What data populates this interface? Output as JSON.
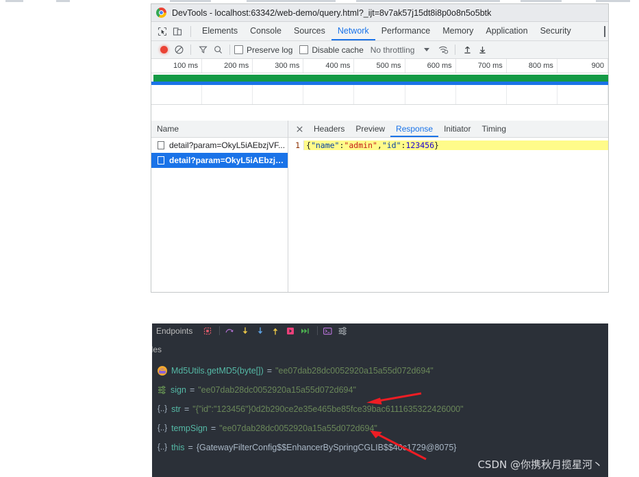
{
  "devtools": {
    "title": "DevTools - localhost:63342/web-demo/query.html?_ijt=8v7ak57j15dt8i8p0o8n5o5btk",
    "logo_name": "chrome-logo",
    "inspect_icon": "inspect-element-icon",
    "device_icon": "device-toolbar-icon",
    "tabs": [
      {
        "label": "Elements",
        "active": false
      },
      {
        "label": "Console",
        "active": false
      },
      {
        "label": "Sources",
        "active": false
      },
      {
        "label": "Network",
        "active": true
      },
      {
        "label": "Performance",
        "active": false
      },
      {
        "label": "Memory",
        "active": false
      },
      {
        "label": "Application",
        "active": false
      },
      {
        "label": "Security",
        "active": false
      }
    ],
    "toolbar": {
      "record_icon": "record-button",
      "clear_icon": "clear-icon",
      "filter_icon": "filter-icon",
      "search_icon": "search-icon",
      "preserve_log_label": "Preserve log",
      "preserve_log_checked": false,
      "disable_cache_label": "Disable cache",
      "disable_cache_checked": false,
      "throttling_value": "No throttling",
      "throttling_caret": "chevron-down-icon",
      "wifi_icon": "network-conditions-icon",
      "import_icon": "import-har-icon",
      "export_icon": "export-har-icon"
    },
    "timeline": {
      "ticks": [
        "100 ms",
        "200 ms",
        "300 ms",
        "400 ms",
        "500 ms",
        "600 ms",
        "700 ms",
        "800 ms",
        "900"
      ],
      "bar_green": "#149a45",
      "bar_blue": "#1a73e8"
    },
    "requests": {
      "column_header": "Name",
      "rows": [
        {
          "name": "detail?param=OkyL5iAEbzjVF...",
          "selected": false
        },
        {
          "name": "detail?param=OkyL5iAEbzjVF...",
          "selected": true
        }
      ]
    },
    "detail": {
      "close_icon": "close-icon",
      "tabs": [
        {
          "label": "Headers",
          "active": false
        },
        {
          "label": "Preview",
          "active": false
        },
        {
          "label": "Response",
          "active": true
        },
        {
          "label": "Initiator",
          "active": false
        },
        {
          "label": "Timing",
          "active": false
        }
      ],
      "response": {
        "line_number": "1",
        "text": "{\"name\":\"admin\",\"id\":123456}",
        "tokens": [
          {
            "t": "{",
            "c": "punc"
          },
          {
            "t": "\"name\"",
            "c": "key"
          },
          {
            "t": ":",
            "c": "punc"
          },
          {
            "t": "\"admin\"",
            "c": "str"
          },
          {
            "t": ",",
            "c": "punc"
          },
          {
            "t": "\"id\"",
            "c": "key"
          },
          {
            "t": ":",
            "c": "punc"
          },
          {
            "t": "123456",
            "c": "num"
          },
          {
            "t": "}",
            "c": "punc"
          }
        ],
        "highlight_color": "#fffb8a"
      }
    }
  },
  "debugger": {
    "tab_label": "Endpoints",
    "toolbar_icons": [
      "mute-breakpoints-icon",
      "step-over-icon",
      "step-into-icon",
      "force-step-into-icon",
      "step-out-icon",
      "run-to-cursor-icon",
      "resume-program-icon",
      "evaluate-expression-icon",
      "settings-icon"
    ],
    "panel_label": "bles",
    "variables": [
      {
        "icon": "method-return-value-icon",
        "name": "Md5Utils.getMD5(byte[])",
        "value": "\"ee07dab28dc0052920a15a55d072d694\"",
        "value_kind": "string",
        "struct": ""
      },
      {
        "icon": "field-icon",
        "name": "sign",
        "value": "\"ee07dab28dc0052920a15a55d072d694\"",
        "value_kind": "string",
        "struct": ""
      },
      {
        "icon": "object-icon",
        "name": "str",
        "value": "\"{\"id\":\"123456\"}0d2b290ce2e35e465be85fce39bac6111635322426000\"",
        "value_kind": "string",
        "struct": "{..}"
      },
      {
        "icon": "object-icon",
        "name": "tempSign",
        "value": "\"ee07dab28dc0052920a15a55d072d694\"",
        "value_kind": "string",
        "struct": "{..}"
      },
      {
        "icon": "object-icon",
        "name": "this",
        "value": "{GatewayFilterConfig$$EnhancerBySpringCGLIB$$40c1729@8075}",
        "value_kind": "object",
        "struct": "{..}"
      }
    ],
    "annotations": [
      {
        "name": "arrow-to-sign",
        "color": "#ee1d24"
      },
      {
        "name": "arrow-to-tempsign",
        "color": "#ee1d24"
      }
    ]
  },
  "watermark": {
    "text": "CSDN @你携秋月揽星河丶"
  }
}
